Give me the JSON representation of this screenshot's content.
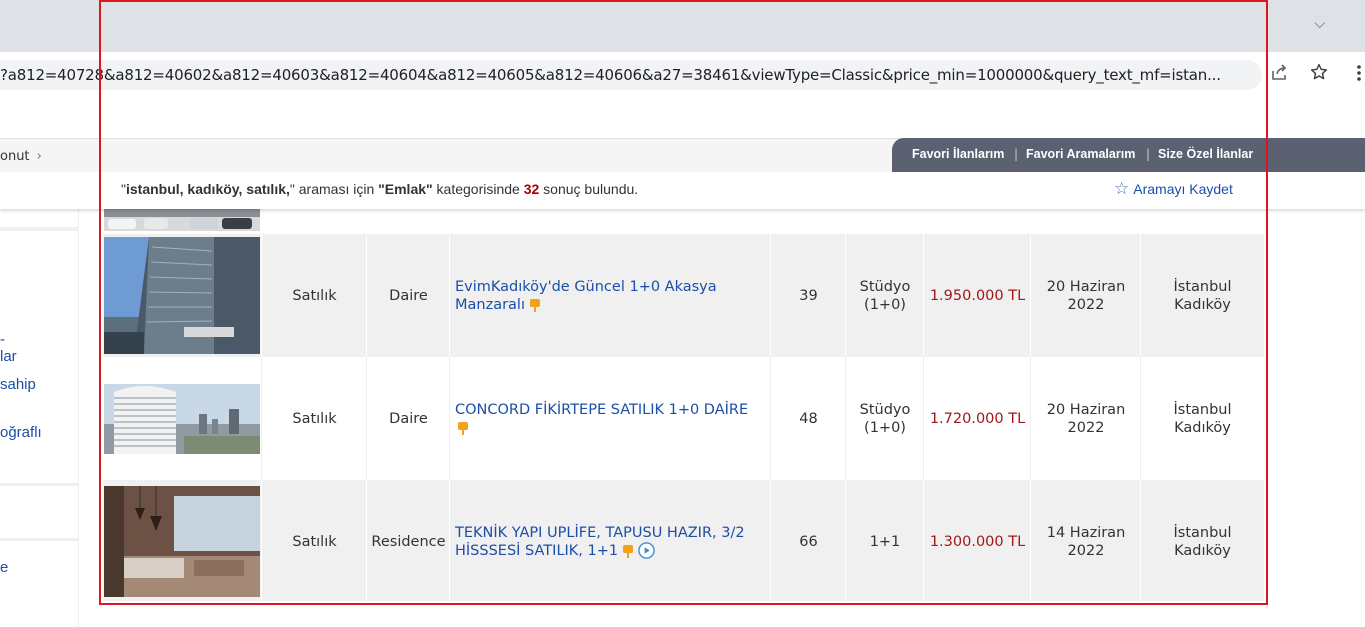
{
  "browser": {
    "url": "?a812=40728&a812=40602&a812=40603&a812=40604&a812=40605&a812=40606&a27=38461&viewType=Classic&price_min=1000000&query_text_mf=istan..."
  },
  "breadcrumb": {
    "text": "onut",
    "chevron": "›"
  },
  "favorites": {
    "items": [
      "Favori İlanlarım",
      "Favori Aramalarım",
      "Size Özel İlanlar"
    ],
    "separator": "|"
  },
  "results": {
    "query": "istanbul, kadıköy, satılık,",
    "middle": " araması için ",
    "category": "Emlak",
    "category_suffix": " kategorisinde ",
    "count": "32",
    "tail": " sonuç bulundu.",
    "save_search": "Aramayı Kaydet",
    "quote": "\""
  },
  "sidebar": {
    "links": [
      "-",
      "lar",
      "sahip",
      "oğraflı",
      "e"
    ]
  },
  "listings": [
    {
      "status": "Satılık",
      "type": "Daire",
      "title_line1": "EvimKadıköy'de Güncel 1+0 Akasya",
      "title_line2": "Manzaralı",
      "m2": "39",
      "rooms_line1": "Stüdyo",
      "rooms_line2": "(1+0)",
      "price": "1.950.000 TL",
      "date_line1": "20 Haziran",
      "date_line2": "2022",
      "loc_line1": "İstanbul",
      "loc_line2": "Kadıköy"
    },
    {
      "status": "Satılık",
      "type": "Daire",
      "title_line1": "CONCORD FİKİRTEPE SATILIK 1+0 DAİRE",
      "title_line2": "",
      "m2": "48",
      "rooms_line1": "Stüdyo",
      "rooms_line2": "(1+0)",
      "price": "1.720.000 TL",
      "date_line1": "20 Haziran",
      "date_line2": "2022",
      "loc_line1": "İstanbul",
      "loc_line2": "Kadıköy"
    },
    {
      "status": "Satılık",
      "type": "Residence",
      "title_line1": "TEKNİK YAPI UPLİFE, TAPUSU HAZIR, 3/2",
      "title_line2": "HİSSSESİ SATILIK, 1+1",
      "m2": "66",
      "rooms_line1": "1+1",
      "rooms_line2": "",
      "price": "1.300.000 TL",
      "date_line1": "14 Haziran",
      "date_line2": "2022",
      "loc_line1": "İstanbul",
      "loc_line2": "Kadıköy"
    }
  ],
  "colors": {
    "link": "#1c4ea8",
    "price": "#a01818",
    "highlight_box": "#e0141e",
    "fav_bar": "#5b6170"
  }
}
